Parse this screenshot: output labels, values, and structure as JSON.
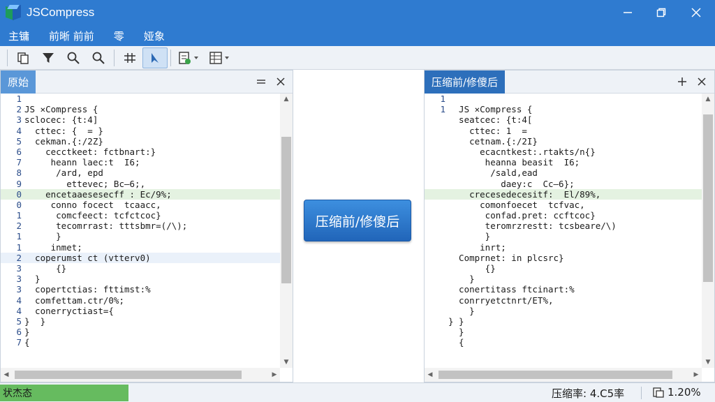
{
  "window": {
    "title": "JSCompress",
    "icon": "app-cube-icon",
    "controls": {
      "minimize": "minimize-icon",
      "maximize": "maximize-icon",
      "close": "close-icon"
    }
  },
  "menu": {
    "items": [
      "主镛",
      "前晰 前前",
      "零",
      "娅象"
    ]
  },
  "toolbar": {
    "buttons": [
      {
        "icon": "copy-icon"
      },
      {
        "icon": "filter-icon"
      },
      {
        "icon": "search-icon"
      },
      {
        "icon": "search-icon"
      },
      {
        "icon": "compress-icon"
      },
      {
        "icon": "cursor-select-icon",
        "active": true
      },
      {
        "icon": "export-icon",
        "dropdown": true
      },
      {
        "icon": "layout-icon",
        "dropdown": true
      }
    ]
  },
  "left_panel": {
    "title": "原始",
    "lines": [
      {
        "num": "1",
        "text": ""
      },
      {
        "num": "2",
        "text": "JS ✕Compress {"
      },
      {
        "num": "3",
        "text": "sclocec: {t:4]"
      },
      {
        "num": "4",
        "text": "  cttec: {  = }"
      },
      {
        "num": "5",
        "text": "  cekman.{:/2Z}"
      },
      {
        "num": "6",
        "text": "    cecctkeet: fctbnart:}"
      },
      {
        "num": "7",
        "text": "     heann laec:t  I6;"
      },
      {
        "num": "8",
        "text": "      /ard, epd"
      },
      {
        "num": "9",
        "text": "        ettevec; Bc—6;,"
      },
      {
        "num": "0",
        "text": "    encetaaesesecff : Ec/9%;",
        "highlight": "green"
      },
      {
        "num": "0",
        "text": "     conno focect  tcaacc,"
      },
      {
        "num": "1",
        "text": "      comcfeect: tcfctcoc}"
      },
      {
        "num": "2",
        "text": "      tecomrrast: tttsbmr=(/\\);"
      },
      {
        "num": "1",
        "text": "      }"
      },
      {
        "num": "1",
        "text": "     inmet;"
      },
      {
        "num": "2",
        "text": "  coperumst ct (vtterv0)",
        "highlight": "blue"
      },
      {
        "num": "3",
        "text": "      {}"
      },
      {
        "num": "3",
        "text": "  }"
      },
      {
        "num": "3",
        "text": "  copertctias: fttimst:%"
      },
      {
        "num": "4",
        "text": "  comfettam.ctr/0%;"
      },
      {
        "num": "4",
        "text": "  conerryctiast={"
      },
      {
        "num": "5",
        "text": "}  }"
      },
      {
        "num": "6",
        "text": "}"
      },
      {
        "num": "7",
        "text": "{"
      }
    ]
  },
  "right_panel": {
    "title": "压缩前/修傻后",
    "lines": [
      {
        "num": "1",
        "text": ""
      },
      {
        "num": "1",
        "text": "  JS ✕Compress {"
      },
      {
        "num": "",
        "text": "  seatcec: {t:4["
      },
      {
        "num": "",
        "text": "    cttec: 1  ="
      },
      {
        "num": "",
        "text": "    cetnam.{:/2I}"
      },
      {
        "num": "",
        "text": "      ecacntkest:.rtakts/n{}"
      },
      {
        "num": "",
        "text": "       heanna beasit  I6;"
      },
      {
        "num": "",
        "text": "        /sald,ead"
      },
      {
        "num": "",
        "text": "          daey:c  Cc—6};"
      },
      {
        "num": "",
        "text": "    crecesedecesitf:  El/89%,",
        "highlight": "green"
      },
      {
        "num": "",
        "text": "      comonfoecet  tcfvac,"
      },
      {
        "num": "",
        "text": "       confad.pret: ccftcoc}"
      },
      {
        "num": "",
        "text": "       teromrzrestt: tcsbeare/\\)"
      },
      {
        "num": "",
        "text": "       }"
      },
      {
        "num": "",
        "text": "      inrt;"
      },
      {
        "num": "",
        "text": "  Comprnet: in plcsrc}"
      },
      {
        "num": "",
        "text": "       {}"
      },
      {
        "num": "",
        "text": "    }"
      },
      {
        "num": "",
        "text": "  conertitass ftcinart:%"
      },
      {
        "num": "",
        "text": "  conrryetctnrt/ET%,"
      },
      {
        "num": "",
        "text": "    }"
      },
      {
        "num": "",
        "text": "} }"
      },
      {
        "num": "",
        "text": "  }"
      },
      {
        "num": "",
        "text": "  {"
      }
    ]
  },
  "action_button": {
    "label": "压缩前/修傻后"
  },
  "status": {
    "label": "状杰态",
    "ratio": "压缩率:  4.C5率",
    "size": "1.20%",
    "size_icon": "file-size-icon"
  }
}
